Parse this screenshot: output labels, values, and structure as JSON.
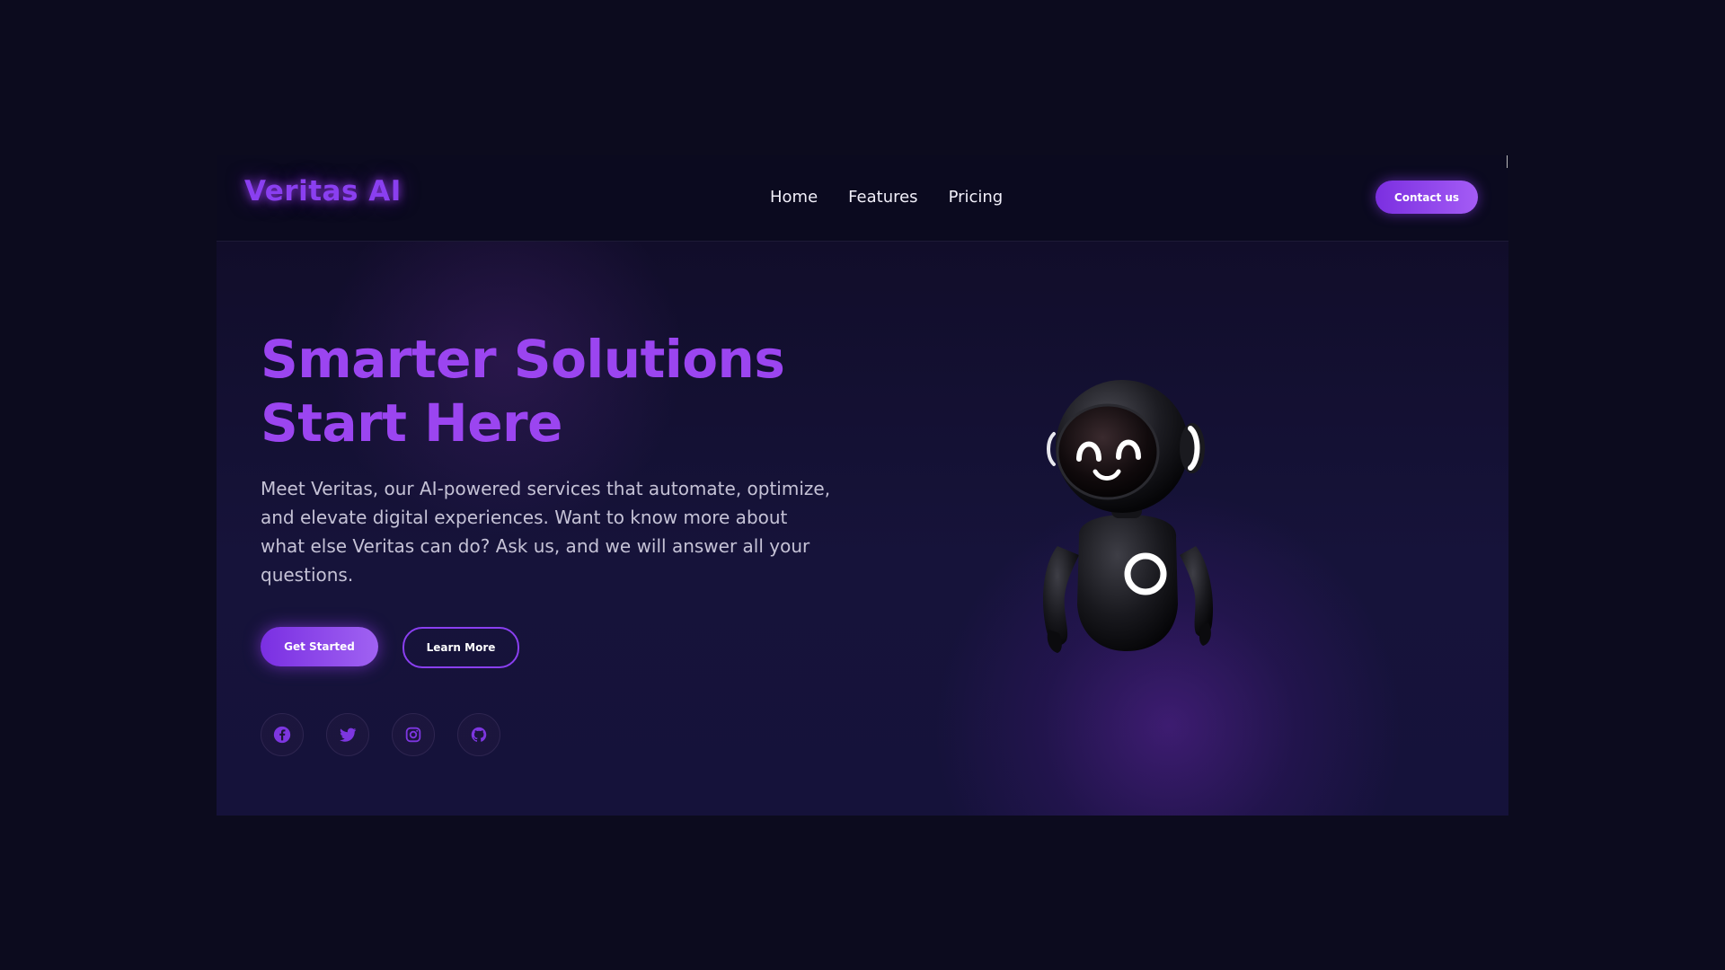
{
  "brand": {
    "name": "Veritas AI"
  },
  "nav": {
    "links": [
      "Home",
      "Features",
      "Pricing"
    ],
    "contact_label": "Contact us"
  },
  "hero": {
    "headline_line1": "Smarter Solutions",
    "headline_line2": "Start Here",
    "description": "Meet Veritas, our AI-powered services that automate, optimize, and elevate digital experiences. Want to know more about what else Veritas can do? Ask us, and we will answer all your questions.",
    "primary_button": "Get Started",
    "secondary_button": "Learn More"
  },
  "socials": [
    {
      "icon": "facebook-icon"
    },
    {
      "icon": "twitter-icon"
    },
    {
      "icon": "instagram-icon"
    },
    {
      "icon": "github-icon"
    }
  ],
  "illustration": {
    "icon": "robot-mascot"
  },
  "colors": {
    "accent": "#8a3ff0",
    "background": "#0c0b1e",
    "text": "#f2f0fa"
  }
}
